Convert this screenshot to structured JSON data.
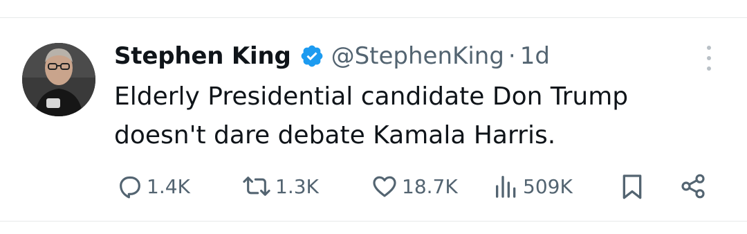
{
  "tweet": {
    "author_name": "Stephen King",
    "author_handle": "@StephenKing",
    "separator": "·",
    "timestamp": "1d",
    "text": "Elderly Presidential candidate Don Trump doesn't dare debate Kamala Harris."
  },
  "actions": {
    "replies": "1.4K",
    "reposts": "1.3K",
    "likes": "18.7K",
    "views": "509K"
  },
  "colors": {
    "verified": "#1d9bf0",
    "secondary_text": "#536471",
    "primary_text": "#0f1419"
  },
  "icons": [
    "verified-badge-icon",
    "more-icon",
    "reply-icon",
    "repost-icon",
    "like-icon",
    "views-icon",
    "bookmark-icon",
    "share-icon"
  ]
}
